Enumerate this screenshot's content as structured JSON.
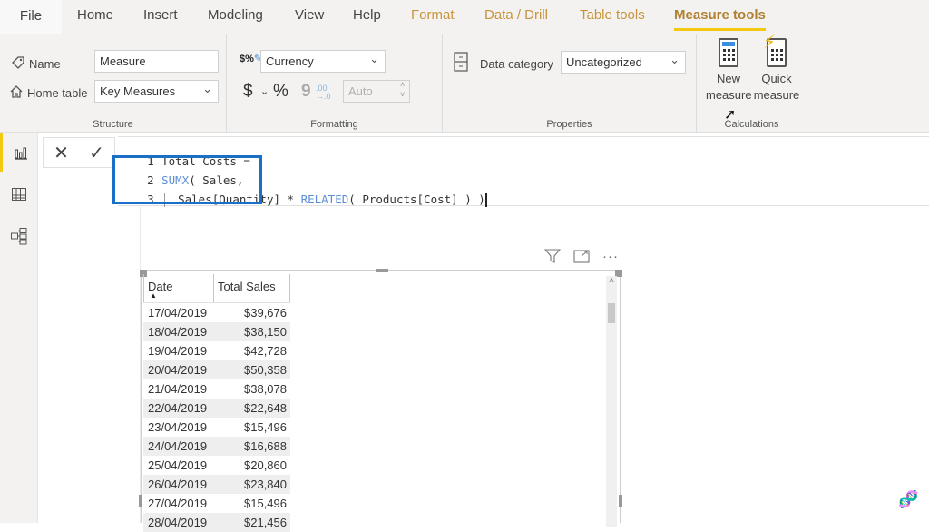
{
  "tabs": [
    {
      "label": "File"
    },
    {
      "label": "Home"
    },
    {
      "label": "Insert"
    },
    {
      "label": "Modeling"
    },
    {
      "label": "View"
    },
    {
      "label": "Help"
    },
    {
      "label": "Format"
    },
    {
      "label": "Data / Drill"
    },
    {
      "label": "Table tools"
    },
    {
      "label": "Measure tools"
    }
  ],
  "ribbon": {
    "structure": {
      "group_label": "Structure",
      "name_label": "Name",
      "name_value": "Measure",
      "home_table_label": "Home table",
      "home_table_value": "Key Measures"
    },
    "formatting": {
      "group_label": "Formatting",
      "format_value": "Currency",
      "currency_symbol": "$",
      "percent_symbol": "%",
      "comma_symbol": "9",
      "decimals_symbol": ".00→.0",
      "decimal_places_placeholder": "Auto"
    },
    "properties": {
      "group_label": "Properties",
      "data_category_label": "Data category",
      "data_category_value": "Uncategorized"
    },
    "calculations": {
      "group_label": "Calculations",
      "new_measure_line1": "New",
      "new_measure_line2": "measure",
      "quick_measure_line1": "Quick",
      "quick_measure_line2": "measure"
    }
  },
  "formula_bar": {
    "cancel_icon": "✕",
    "commit_icon": "✓",
    "lines": [
      {
        "num": "1",
        "code": "Total Costs ="
      },
      {
        "num": "2",
        "fn": "SUMX",
        "rest": "( Sales,"
      },
      {
        "num": "3",
        "pre": "Sales[Quantity] * ",
        "fn": "RELATED",
        "rest": "( Products[Cost] ) )"
      }
    ]
  },
  "table": {
    "columns": [
      "Date",
      "Total Sales"
    ],
    "rows": [
      [
        "17/04/2019",
        "$39,676"
      ],
      [
        "18/04/2019",
        "$38,150"
      ],
      [
        "19/04/2019",
        "$42,728"
      ],
      [
        "20/04/2019",
        "$50,358"
      ],
      [
        "21/04/2019",
        "$38,078"
      ],
      [
        "22/04/2019",
        "$22,648"
      ],
      [
        "23/04/2019",
        "$15,496"
      ],
      [
        "24/04/2019",
        "$16,688"
      ],
      [
        "25/04/2019",
        "$20,860"
      ],
      [
        "26/04/2019",
        "$23,840"
      ],
      [
        "27/04/2019",
        "$15,496"
      ],
      [
        "28/04/2019",
        "$21,456"
      ]
    ]
  },
  "colors": {
    "accent": "#f2c811",
    "highlight_box": "#1a6fc7",
    "context_tab": "#c8943c"
  }
}
